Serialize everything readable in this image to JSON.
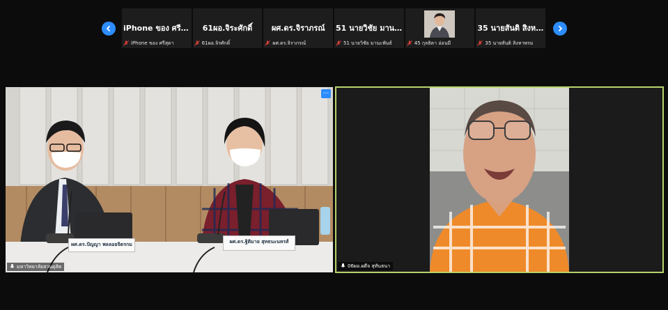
{
  "thumbnails": [
    {
      "name": "iPhone ของ ศรีสุดา",
      "sub": "iPhone ของ ศรีสุดา",
      "has_photo": false
    },
    {
      "name": "61ผอ.จิระศักดิ์",
      "sub": "61ผอ.จิรศักดิ์",
      "has_photo": false
    },
    {
      "name": "ผศ.ดร.จิราภรณ์",
      "sub": "ผศ.ดร.จิราภรณ์",
      "has_photo": false
    },
    {
      "name": "51 นายวิชัย มานะ...",
      "sub": "51 นายวิชัย มานะพันธ์",
      "has_photo": false
    },
    {
      "name": "",
      "sub": "45 กุลธิดา อ่อนมี",
      "has_photo": true
    },
    {
      "name": "35 นายสันติ สิงห...",
      "sub": "35 นายสันติ สิงหาพรม",
      "has_photo": false
    }
  ],
  "videos": {
    "left": {
      "label": "มหาวิทยาลัยสวนดุสิต",
      "more": "...",
      "nameplate_1": "ผศ.ดร.ปัญญา พลลอยจิตรกม",
      "nameplate_2": "ผศ.ดร.ฐิติมาย สุทธนะนทรส์"
    },
    "right": {
      "label": "06ผอ.ผดีจ สุทันธนา"
    }
  },
  "colors": {
    "accent": "#2d8cff",
    "active_speaker_border": "#b9d46b",
    "mic_muted": "#e0413a"
  }
}
